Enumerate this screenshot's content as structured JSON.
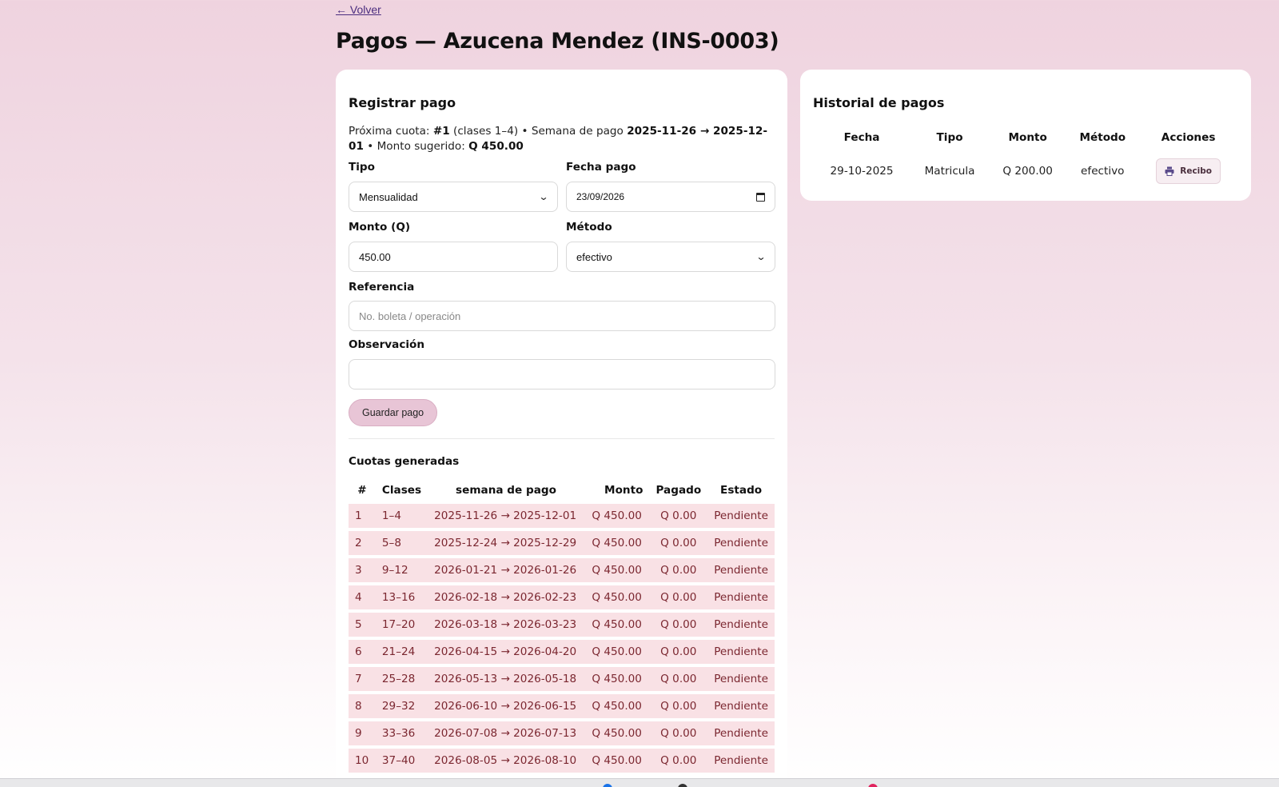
{
  "nav": {
    "back_label": "← Volver"
  },
  "page": {
    "title": "Pagos — Azucena Mendez (INS-0003)"
  },
  "register": {
    "heading": "Registrar pago",
    "info": {
      "prefix": "Próxima cuota: ",
      "quota": "#1",
      "classes": " (clases 1–4) • Semana de pago ",
      "week": "2025-11-26 → 2025-12-01",
      "mid": " • Monto sugerido: ",
      "amount": "Q 450.00"
    },
    "tipo": {
      "label": "Tipo",
      "value": "Mensualidad"
    },
    "fecha": {
      "label": "Fecha pago",
      "value": "23/09/2026"
    },
    "monto": {
      "label": "Monto (Q)",
      "value": "450.00"
    },
    "metodo": {
      "label": "Método",
      "value": "efectivo"
    },
    "referencia": {
      "label": "Referencia",
      "placeholder": "No. boleta / operación"
    },
    "observacion": {
      "label": "Observación",
      "value": ""
    },
    "save_label": "Guardar pago"
  },
  "quotas": {
    "heading": "Cuotas generadas",
    "columns": [
      "#",
      "Clases",
      "semana de pago",
      "Monto",
      "Pagado",
      "Estado"
    ],
    "rows": [
      {
        "n": "1",
        "clases": "1–4",
        "semana": "2025-11-26 → 2025-12-01",
        "monto": "Q 450.00",
        "pagado": "Q 0.00",
        "estado": "Pendiente"
      },
      {
        "n": "2",
        "clases": "5–8",
        "semana": "2025-12-24 → 2025-12-29",
        "monto": "Q 450.00",
        "pagado": "Q 0.00",
        "estado": "Pendiente"
      },
      {
        "n": "3",
        "clases": "9–12",
        "semana": "2026-01-21 → 2026-01-26",
        "monto": "Q 450.00",
        "pagado": "Q 0.00",
        "estado": "Pendiente"
      },
      {
        "n": "4",
        "clases": "13–16",
        "semana": "2026-02-18 → 2026-02-23",
        "monto": "Q 450.00",
        "pagado": "Q 0.00",
        "estado": "Pendiente"
      },
      {
        "n": "5",
        "clases": "17–20",
        "semana": "2026-03-18 → 2026-03-23",
        "monto": "Q 450.00",
        "pagado": "Q 0.00",
        "estado": "Pendiente"
      },
      {
        "n": "6",
        "clases": "21–24",
        "semana": "2026-04-15 → 2026-04-20",
        "monto": "Q 450.00",
        "pagado": "Q 0.00",
        "estado": "Pendiente"
      },
      {
        "n": "7",
        "clases": "25–28",
        "semana": "2026-05-13 → 2026-05-18",
        "monto": "Q 450.00",
        "pagado": "Q 0.00",
        "estado": "Pendiente"
      },
      {
        "n": "8",
        "clases": "29–32",
        "semana": "2026-06-10 → 2026-06-15",
        "monto": "Q 450.00",
        "pagado": "Q 0.00",
        "estado": "Pendiente"
      },
      {
        "n": "9",
        "clases": "33–36",
        "semana": "2026-07-08 → 2026-07-13",
        "monto": "Q 450.00",
        "pagado": "Q 0.00",
        "estado": "Pendiente"
      },
      {
        "n": "10",
        "clases": "37–40",
        "semana": "2026-08-05 → 2026-08-10",
        "monto": "Q 450.00",
        "pagado": "Q 0.00",
        "estado": "Pendiente"
      }
    ]
  },
  "history": {
    "heading": "Historial de pagos",
    "columns": [
      "Fecha",
      "Tipo",
      "Monto",
      "Método",
      "Acciones"
    ],
    "rows": [
      {
        "fecha": "29-10-2025",
        "tipo": "Matricula",
        "monto": "Q 200.00",
        "metodo": "efectivo",
        "action": "Recibo",
        "icon": "printer-icon"
      }
    ]
  },
  "colors": {
    "row_bg": "#f9e1e5",
    "row_text": "#7b2730",
    "save_button": "#e8c5d6",
    "link": "#4b2d7f"
  }
}
